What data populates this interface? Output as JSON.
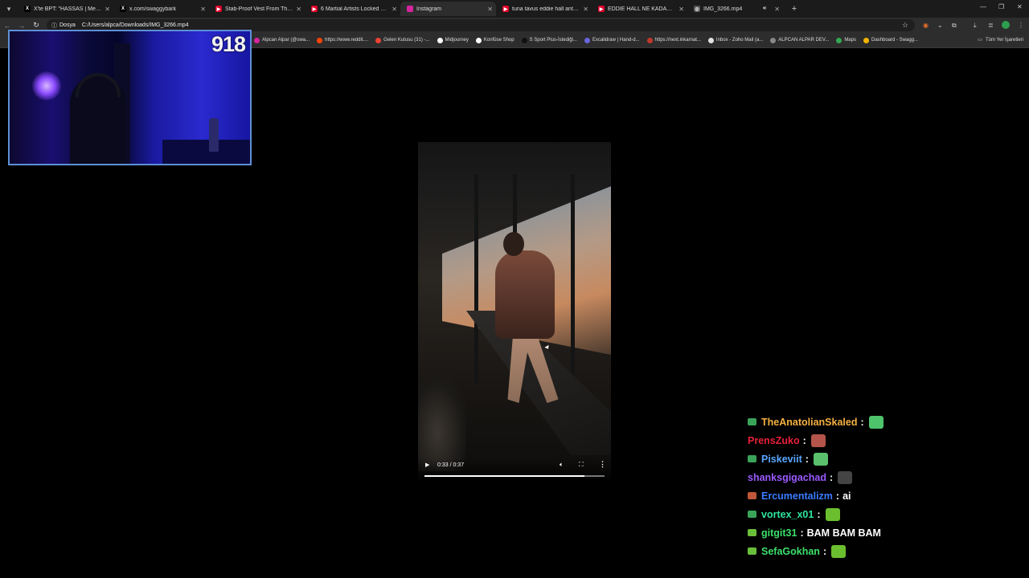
{
  "tabs": [
    {
      "title": "X'te BPT: \"HASSAS | Mersin'de ",
      "fav": "X",
      "color": "#000000",
      "active": false
    },
    {
      "title": "x.com/swaggybark",
      "fav": "X",
      "color": "#000000",
      "active": false
    },
    {
      "title": "Stab-Proof Vest From The UK - ",
      "fav": "▶",
      "color": "#e0002a",
      "active": false
    },
    {
      "title": "6 Martial Artists Locked with a ",
      "fav": "▶",
      "color": "#e0002a",
      "active": false
    },
    {
      "title": "Instagram",
      "fav": "",
      "color": "#d6249f",
      "active": true
    },
    {
      "title": "tuna tavus eddie hall antrenm...",
      "fav": "▶",
      "color": "#e0002a",
      "active": false
    },
    {
      "title": "EDDIE HALL NE KADAR GÜÇLÜ",
      "fav": "▶",
      "color": "#e0002a",
      "active": false
    },
    {
      "title": "IMG_3266.mp4",
      "fav": "◎",
      "color": "#555555",
      "active": false
    }
  ],
  "address": {
    "chip": "Dosya",
    "url": "C:/Users/alpca/Downloads/IMG_3266.mp4"
  },
  "bookmarks": [
    {
      "label": "Alpcan Alpar (@swa...",
      "color": "#d6249f"
    },
    {
      "label": "https://www.reddit....",
      "color": "#ff4500"
    },
    {
      "label": "Gelen Kutusu (31) -...",
      "color": "#ea4335"
    },
    {
      "label": "Midjourney",
      "color": "#ffffff"
    },
    {
      "label": "Konfüse Shop",
      "color": "#ffffff"
    },
    {
      "label": "S Sport Plus-İstediği...",
      "color": "#111111"
    },
    {
      "label": "Excalidraw | Hand-d...",
      "color": "#6965db"
    },
    {
      "label": "https://next.inkarnat...",
      "color": "#c0392b"
    },
    {
      "label": "Inbox - Zoho Mail (a...",
      "color": "#e2e2e2"
    },
    {
      "label": "ALPCAN ALPAR DEV...",
      "color": "#888888"
    },
    {
      "label": "Maps",
      "color": "#34a853"
    },
    {
      "label": "Dashboard - Swagg...",
      "color": "#f4b400"
    }
  ],
  "all_bookmarks": "Tüm Yer İşaretleri",
  "webcam": {
    "counter": "918"
  },
  "video": {
    "time": "0:33 / 0:37",
    "progress": 0.89
  },
  "chat": [
    {
      "user": "TheAnatolianSkaled",
      "color": "#f5b042",
      "badge": "#3aa35a",
      "text": "",
      "emote": "#4fc36b"
    },
    {
      "user": "PrensZuko",
      "color": "#e8213a",
      "badge": "",
      "text": "",
      "emote": "#b5544a"
    },
    {
      "user": "Piskeviit",
      "color": "#5aa6ff",
      "badge": "#3aa35a",
      "text": "",
      "emote": "#5ac06b"
    },
    {
      "user": "shanksgigachad",
      "color": "#9b59ff",
      "badge": "",
      "text": "",
      "emote": "#444444"
    },
    {
      "user": "Ercumentalizm",
      "color": "#3a7bff",
      "badge": "#c0563a",
      "text": "ai",
      "emote": ""
    },
    {
      "user": "vortex_x01",
      "color": "#2ee59d",
      "badge": "#3aa35a",
      "text": "",
      "emote": "#6bbf2f"
    },
    {
      "user": "gitgit31",
      "color": "#3de06a",
      "badge": "#6abf3a",
      "text": "BAM BAM BAM",
      "emote": ""
    },
    {
      "user": "SefaGokhan",
      "color": "#3de06a",
      "badge": "#6abf3a",
      "text": "",
      "emote": "#6bbf2f"
    }
  ]
}
